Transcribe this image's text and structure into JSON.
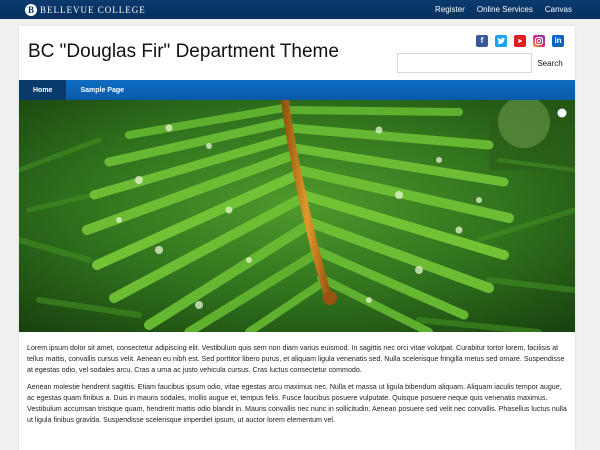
{
  "topbar": {
    "brand_initial": "B",
    "brand_name": "BELLEVUE COLLEGE",
    "links": [
      "Register",
      "Online Services",
      "Canvas"
    ]
  },
  "header": {
    "site_title": "BC \"Douglas Fir\" Department Theme",
    "social_icons": [
      "facebook-icon",
      "twitter-icon",
      "youtube-icon",
      "instagram-icon",
      "linkedin-icon"
    ]
  },
  "search": {
    "value": "",
    "button_label": "Search"
  },
  "nav": {
    "items": [
      "Home",
      "Sample Page"
    ],
    "active": "Home"
  },
  "hero": {
    "subject": "green fir branch with water droplets"
  },
  "content": {
    "paragraphs": [
      "Lorem ipsum dolor sit amet, consectetur adipiscing elit. Vestibulum quis sem non diam varius euismod. In sagittis nec orci vitae volutpat. Curabitur tortor lorem, facilisis at tellus mattis, convallis cursus velit. Aenean eu nibh est. Sed porttitor libero purus, et aliquam ligula venenatis sed. Nulla scelerisque fringilla metus sed ornare. Suspendisse at egestas odio, vel sodales arcu. Cras a urna ac justo vehicula cursus. Cras luctus consectetur commodo.",
      "Aenean molestie hendrerit sagittis. Etiam faucibus ipsum odio, vitae egestas arcu maximus nec. Nulla et massa ut ligula bibendum aliquam. Aliquam iaculis tempor augue, ac egestas quam finibus a. Duis in mauris sodales, mollis augue et, tempus felis. Fusce faucibus posuere vulputate. Quisque posuere neque quis venenatis maximus. Vestibulum accumsan tristique quam, hendrerit mattis odio blandit in. Mauris convallis nec nunc in sollicitudin. Aenean posuere sed velit nec convallis. Phasellus luctus nulla ut ligula finibus gravida. Suspendisse scelerisque imperdiet ipsum, ut auctor lorem elementum vel."
    ]
  },
  "colors": {
    "topbar": "#06305f",
    "nav": "#0a5aa8",
    "nav_active": "#083a6b",
    "page_bg": "#f0f0f0"
  }
}
